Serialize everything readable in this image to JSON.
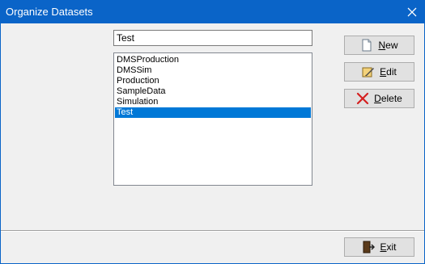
{
  "window": {
    "title": "Organize Datasets"
  },
  "name_field": {
    "value": "Test"
  },
  "datasets": {
    "items": [
      "DMSProduction",
      "DMSSim",
      "Production",
      "SampleData",
      "Simulation",
      "Test"
    ],
    "selected": "Test"
  },
  "buttons": {
    "new": {
      "label_first": "N",
      "label_rest": "ew"
    },
    "edit": {
      "label_first": "E",
      "label_rest": "dit"
    },
    "delete": {
      "label_first": "D",
      "label_rest": "elete"
    },
    "exit": {
      "label_first": "E",
      "label_rest": "xit"
    }
  },
  "icons": {
    "close": "close-icon",
    "new": "new-document-icon",
    "edit": "edit-icon",
    "delete": "delete-x-icon",
    "exit": "exit-door-icon"
  },
  "colors": {
    "titlebar": "#0a64c8",
    "selection": "#0078d7",
    "delete_icon": "#d42020"
  }
}
